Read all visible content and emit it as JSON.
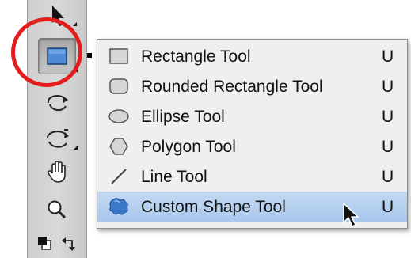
{
  "menu": {
    "items": [
      {
        "label": "Rectangle Tool",
        "key": "U",
        "icon": "rectangle-shape-icon"
      },
      {
        "label": "Rounded Rectangle Tool",
        "key": "U",
        "icon": "rounded-rectangle-shape-icon"
      },
      {
        "label": "Ellipse Tool",
        "key": "U",
        "icon": "ellipse-shape-icon"
      },
      {
        "label": "Polygon Tool",
        "key": "U",
        "icon": "polygon-shape-icon"
      },
      {
        "label": "Line Tool",
        "key": "U",
        "icon": "line-shape-icon"
      },
      {
        "label": "Custom Shape Tool",
        "key": "U",
        "icon": "custom-shape-icon",
        "highlighted": true
      }
    ]
  },
  "toolbar": {
    "tools": [
      "move-tool-icon",
      "rectangle-tool-icon",
      "path-selection-icon",
      "rotate-view-icon",
      "hand-tool-icon",
      "zoom-tool-icon",
      "default-colors-icon",
      "swap-colors-icon"
    ]
  },
  "colors": {
    "highlight_ring": "#e21d1d",
    "menu_highlight": "#b3cfee",
    "shape_blue": "#3b78c9"
  }
}
